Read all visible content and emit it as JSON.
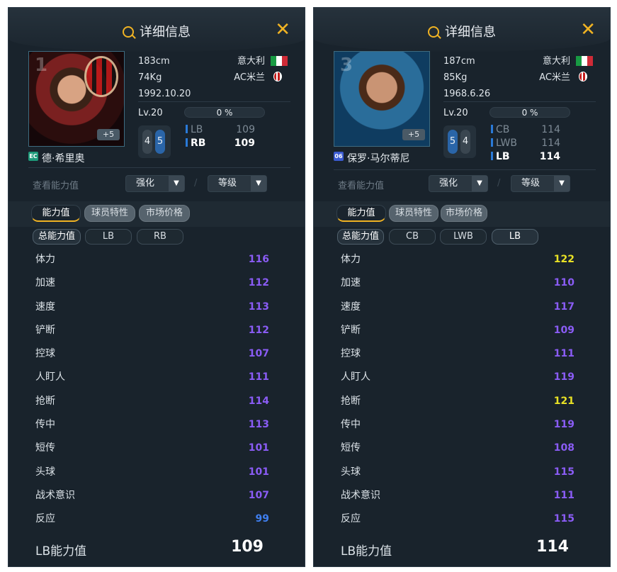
{
  "panels": [
    {
      "title": "详细信息",
      "photo_number": "1",
      "photo_plus": "+5",
      "season_badge": "EC",
      "player_name": "德·希里奥",
      "height": "183cm",
      "weight": "74Kg",
      "birth": "1992.10.20",
      "nationality": "意大利",
      "club": "AC米兰",
      "level": "Lv.20",
      "exp_percent": "0 %",
      "foot_left": "4",
      "foot_right": "5",
      "positions": [
        {
          "name": "LB",
          "value": "109",
          "active": false
        },
        {
          "name": "RB",
          "value": "109",
          "active": true
        }
      ],
      "view_label": "查看能力值",
      "select_enhance": "强化",
      "select_level": "等级",
      "slash": "/",
      "tabs": [
        "能力值",
        "球员特性",
        "市场价格"
      ],
      "pills": [
        "总能力值",
        "LB",
        "RB"
      ],
      "stats": [
        {
          "label": "体力",
          "value": "116",
          "color": "#8a5cf5"
        },
        {
          "label": "加速",
          "value": "112",
          "color": "#8a5cf5"
        },
        {
          "label": "速度",
          "value": "113",
          "color": "#8a5cf5"
        },
        {
          "label": "铲断",
          "value": "112",
          "color": "#8a5cf5"
        },
        {
          "label": "控球",
          "value": "107",
          "color": "#8a5cf5"
        },
        {
          "label": "人盯人",
          "value": "111",
          "color": "#8a5cf5"
        },
        {
          "label": "抢断",
          "value": "114",
          "color": "#8a5cf5"
        },
        {
          "label": "传中",
          "value": "113",
          "color": "#8a5cf5"
        },
        {
          "label": "短传",
          "value": "101",
          "color": "#8a5cf5"
        },
        {
          "label": "头球",
          "value": "101",
          "color": "#8a5cf5"
        },
        {
          "label": "战术意识",
          "value": "107",
          "color": "#8a5cf5"
        },
        {
          "label": "反应",
          "value": "99",
          "color": "#3f7ff0"
        }
      ],
      "footer_label": "LB能力值",
      "footer_value": "109"
    },
    {
      "title": "详细信息",
      "photo_number": "3",
      "photo_plus": "+5",
      "season_badge": "06",
      "player_name": "保罗·马尔蒂尼",
      "height": "187cm",
      "weight": "85Kg",
      "birth": "1968.6.26",
      "nationality": "意大利",
      "club": "AC米兰",
      "level": "Lv.20",
      "exp_percent": "0 %",
      "foot_left": "5",
      "foot_right": "4",
      "positions": [
        {
          "name": "CB",
          "value": "114",
          "active": false
        },
        {
          "name": "LWB",
          "value": "114",
          "active": false
        },
        {
          "name": "LB",
          "value": "114",
          "active": true
        }
      ],
      "view_label": "查看能力值",
      "select_enhance": "强化",
      "select_level": "等级",
      "slash": "/",
      "tabs": [
        "能力值",
        "球员特性",
        "市场价格"
      ],
      "pills": [
        "总能力值",
        "CB",
        "LWB",
        "LB"
      ],
      "stats": [
        {
          "label": "体力",
          "value": "122",
          "color": "#e8e125"
        },
        {
          "label": "加速",
          "value": "110",
          "color": "#8a5cf5"
        },
        {
          "label": "速度",
          "value": "117",
          "color": "#8a5cf5"
        },
        {
          "label": "铲断",
          "value": "109",
          "color": "#8a5cf5"
        },
        {
          "label": "控球",
          "value": "111",
          "color": "#8a5cf5"
        },
        {
          "label": "人盯人",
          "value": "119",
          "color": "#8a5cf5"
        },
        {
          "label": "抢断",
          "value": "121",
          "color": "#e8e125"
        },
        {
          "label": "传中",
          "value": "119",
          "color": "#8a5cf5"
        },
        {
          "label": "短传",
          "value": "108",
          "color": "#8a5cf5"
        },
        {
          "label": "头球",
          "value": "115",
          "color": "#8a5cf5"
        },
        {
          "label": "战术意识",
          "value": "111",
          "color": "#8a5cf5"
        },
        {
          "label": "反应",
          "value": "115",
          "color": "#8a5cf5"
        }
      ],
      "footer_label": "LB能力值",
      "footer_value": "114"
    }
  ]
}
